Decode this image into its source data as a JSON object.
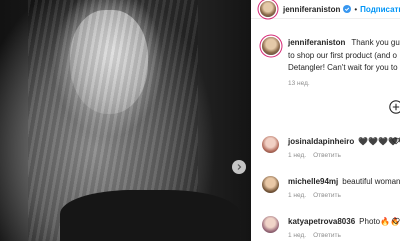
{
  "post": {
    "username": "jenniferaniston",
    "separator": "•",
    "follow_label": "Подписаться"
  },
  "caption": {
    "username": "jenniferaniston",
    "line1": "Thank you guys",
    "line2": "to shop our first product (and o",
    "line3": "Detangler! Can't wait for you to",
    "time": "13 нед."
  },
  "comments": [
    {
      "username": "josinaldapinheiro",
      "text": "🖤🖤🖤🖤🖤",
      "time": "1 нед.",
      "reply": "Ответить"
    },
    {
      "username": "michelle94mj",
      "text": "beautiful woman",
      "time": "1 нед.",
      "reply": "Ответить"
    },
    {
      "username": "katyapetrova8036",
      "text": "Photo🔥🔥",
      "time": "1 нед.",
      "reply": "Ответить"
    }
  ],
  "colors": {
    "accent": "#0095f6",
    "muted": "#8e8e8e",
    "text": "#262626"
  }
}
